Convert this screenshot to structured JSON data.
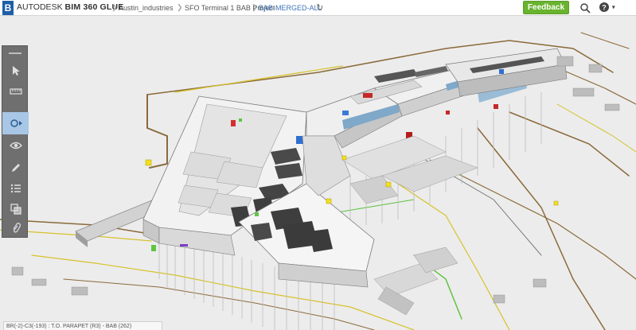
{
  "app": {
    "brand_prefix": "AUTODESK",
    "brand_name": "BIM 360",
    "brand_suffix": "GLUE",
    "logo_letter": "B"
  },
  "breadcrumb": {
    "items": [
      {
        "label": "Austin_industries"
      },
      {
        "label": "SFO Terminal 1 BAB Project"
      },
      {
        "label": "BAB-MERGED-ALL"
      }
    ]
  },
  "header": {
    "feedback_label": "Feedback",
    "help_label": "?",
    "help_caret": "▾",
    "refresh_icon": "refresh-icon",
    "search_icon": "search-icon"
  },
  "toolbar": {
    "tools": [
      {
        "name": "select",
        "icon": "cursor-icon"
      },
      {
        "name": "measure",
        "icon": "ruler-icon"
      },
      {
        "name": "navigate",
        "icon": "orbit-icon",
        "active": true
      },
      {
        "name": "view",
        "icon": "eye-icon"
      },
      {
        "name": "markup",
        "icon": "pen-icon"
      },
      {
        "name": "list",
        "icon": "list-icon"
      },
      {
        "name": "sections",
        "icon": "box-icon"
      },
      {
        "name": "attach",
        "icon": "clip-icon"
      }
    ]
  },
  "status": {
    "text": "BR(-2)-C3(-193) : T.O. PARAPET (R3) - BAB (262)"
  },
  "colors": {
    "accent": "#69b32f",
    "brand": "#1f5fa8",
    "link": "#3d74b8",
    "toolbar": "#6f6f6f",
    "toolbar_active": "#a8c7e6"
  }
}
